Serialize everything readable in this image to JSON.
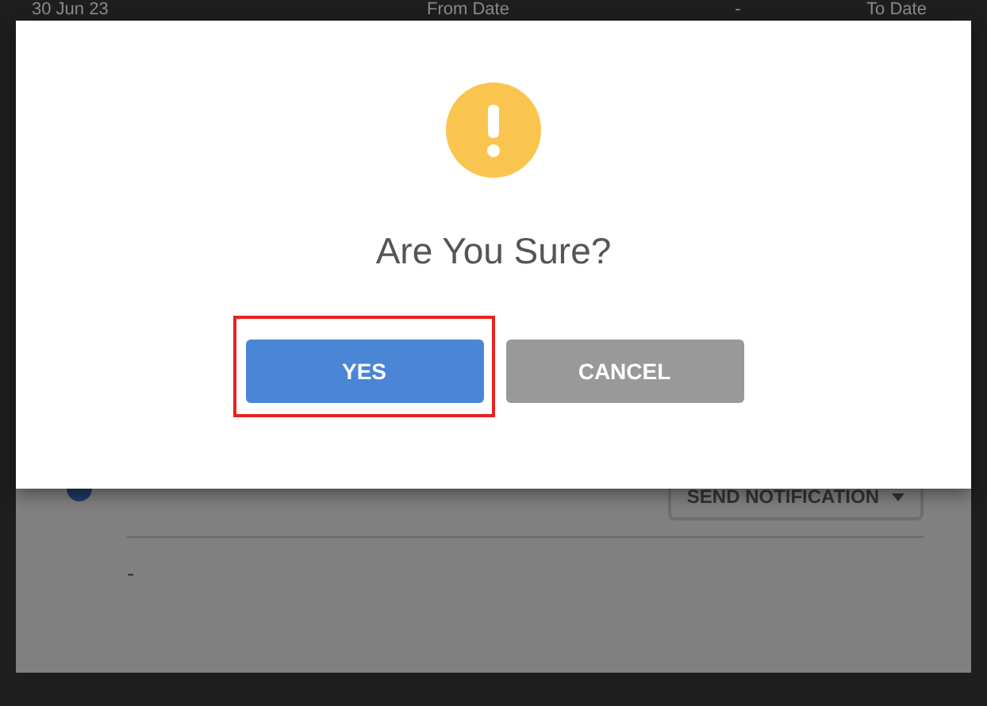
{
  "background_filters": [
    "30 Jun 23",
    "From Date",
    "-",
    "To Date"
  ],
  "dialog": {
    "title": "Are You Sure?",
    "buttons": [
      {
        "label": "YES",
        "kind": "confirm",
        "selected": true
      },
      {
        "label": "CANCEL",
        "kind": "cancel",
        "selected": false
      }
    ]
  },
  "panel": {
    "action_button": "SEND NOTIFICATION",
    "value": "-"
  }
}
